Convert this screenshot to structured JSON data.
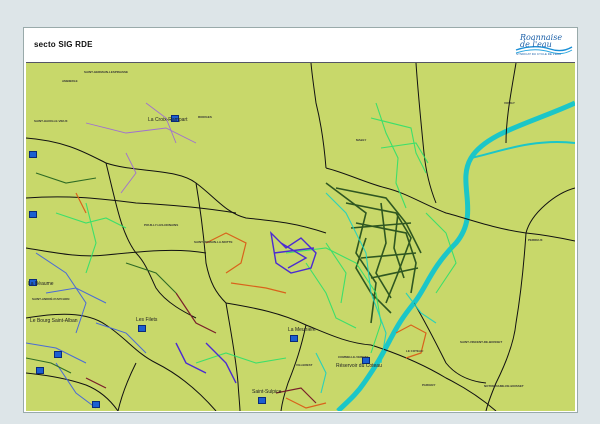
{
  "header": {
    "title": "secto SIG RDE"
  },
  "logo": {
    "name": "Roannaise de l'eau",
    "line1": "Roannaise",
    "line2": "de l'eau",
    "tagline": "SYNDICAT DU CYCLE DE L'EAU"
  },
  "colors": {
    "land": "#c8d86a",
    "river": "#1bc6c8",
    "boundary": "#111111",
    "facility_marker": "#1b5fd1",
    "sheet": "#ffffff"
  },
  "facility_icon": "square-marker-icon",
  "map": {
    "major_labels": [
      "La Croix-Rampart",
      "La Bèaume",
      "Le Bourg Saint-Alban",
      "Les Filets",
      "La Meunière",
      "Réservoir du Coteau",
      "Saint-Sulpice"
    ],
    "commune_labels": [
      "SAINT-GERMAIN-LESPINASSE",
      "AMBIERLE",
      "SAINT-HAON-LE-VIEUX",
      "RIORGES",
      "MABLY",
      "VOUGY",
      "POUILLY-LES-NONAINS",
      "SAINT-ROMAIN-LA-MOTTE",
      "PERREUX",
      "SAINT-ANDRÉ-D'APCHON",
      "COMMELLE-VERNAY",
      "SAINT-VINCENT-DE-BOISSET",
      "PARIGNY",
      "NOTRE-DAME-DE-BOISSET",
      "LE COTEAU",
      "VILLEREST"
    ]
  }
}
